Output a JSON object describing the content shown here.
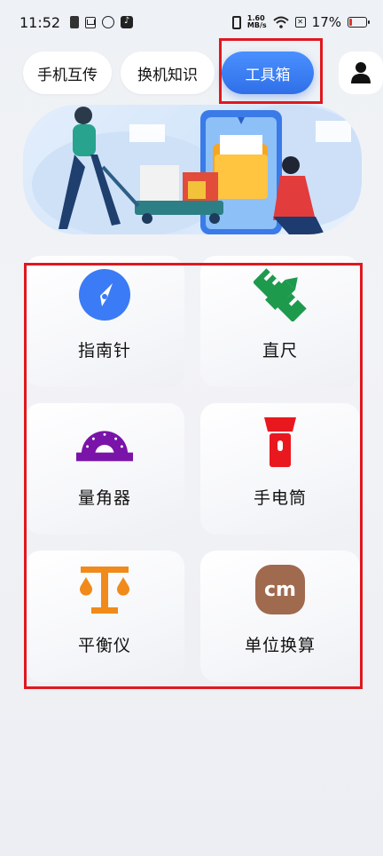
{
  "status_bar": {
    "time": "11:52",
    "net_speed_top": "1.60",
    "net_speed_unit": "MB/s",
    "battery_percent": "17%",
    "battery_level": 0.17,
    "icons": [
      "phone-icon",
      "mail-icon",
      "chat-icon",
      "tiktok-icon",
      "vibrate-icon",
      "wifi-icon",
      "x-box-icon",
      "battery-icon"
    ]
  },
  "nav": {
    "tabs": [
      {
        "label": "手机互传"
      },
      {
        "label": "换机知识"
      },
      {
        "label": "工具箱"
      }
    ],
    "active_tab": "工具箱",
    "user_icon": "user-icon"
  },
  "tools": [
    {
      "label": "指南针",
      "icon": "compass-icon",
      "color": "#3b7bf5"
    },
    {
      "label": "直尺",
      "icon": "ruler-icon",
      "color": "#1e9a4d"
    },
    {
      "label": "量角器",
      "icon": "protractor-icon",
      "color": "#7a14a8"
    },
    {
      "label": "手电筒",
      "icon": "flashlight-icon",
      "color": "#e9181f"
    },
    {
      "label": "平衡仪",
      "icon": "level-icon",
      "color": "#f08a1a"
    },
    {
      "label": "单位换算",
      "icon": "unit-convert-icon",
      "color": "#a06a4e",
      "icon_text": "cm"
    }
  ],
  "colors": {
    "accent": "#2f6fe8",
    "highlight": "#e0181f"
  }
}
